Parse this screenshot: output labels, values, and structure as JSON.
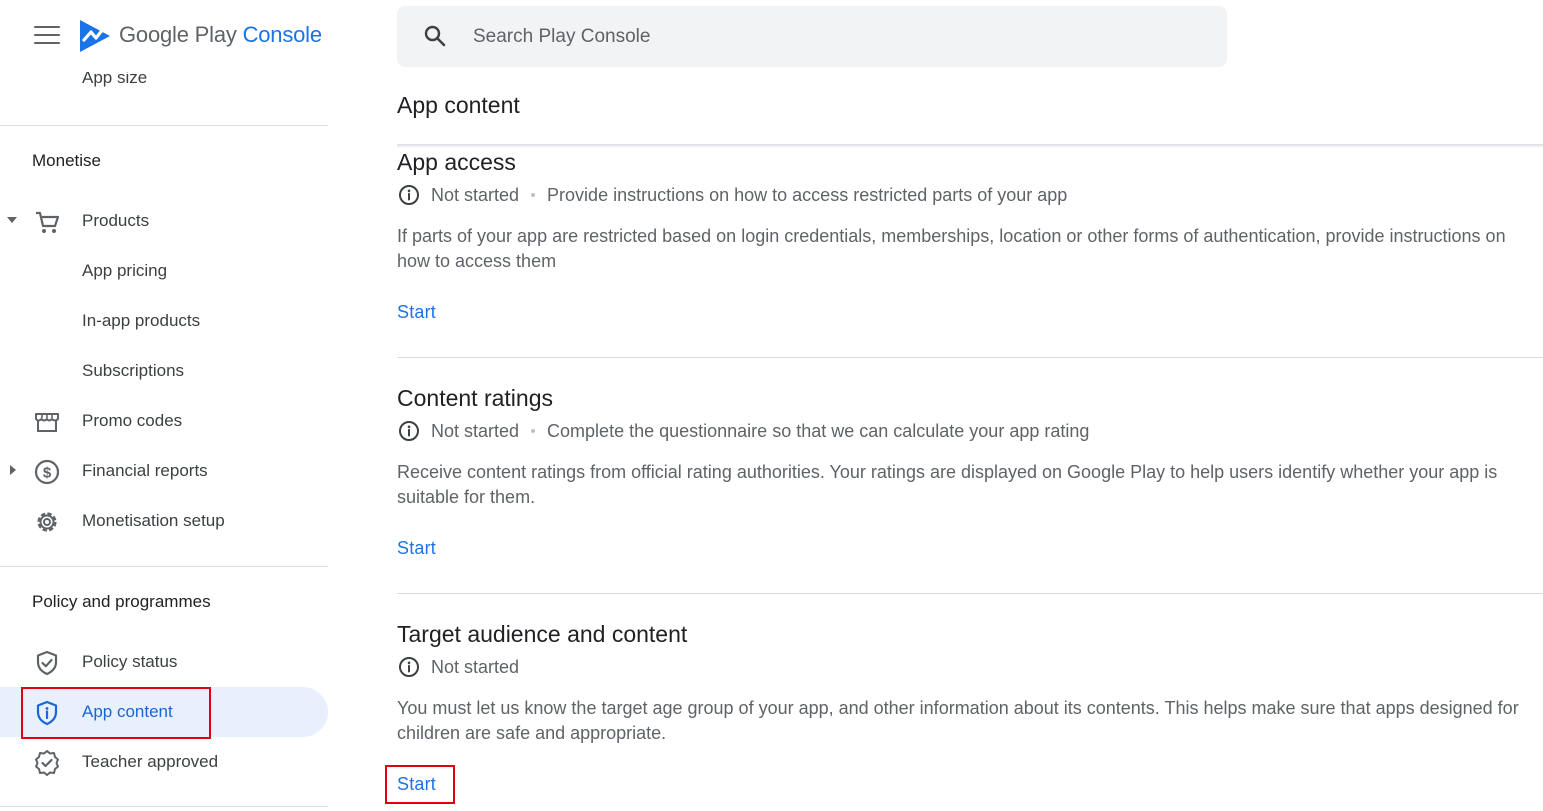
{
  "header": {
    "brand_google_play": "Google Play",
    "brand_console": "Console"
  },
  "search": {
    "placeholder": "Search Play Console"
  },
  "sidebar": {
    "partial_item": "App size",
    "monetise": {
      "title": "Monetise",
      "items": [
        {
          "label": "Products",
          "icon": "cart-icon",
          "expanded": true
        },
        {
          "label": "App pricing"
        },
        {
          "label": "In-app products"
        },
        {
          "label": "Subscriptions"
        },
        {
          "label": "Promo codes",
          "icon": "store-icon"
        },
        {
          "label": "Financial reports",
          "icon": "dollar-icon",
          "expanded": false
        },
        {
          "label": "Monetisation setup",
          "icon": "gear-icon"
        }
      ]
    },
    "policy": {
      "title": "Policy and programmes",
      "items": [
        {
          "label": "Policy status",
          "icon": "shield-check-icon"
        },
        {
          "label": "App content",
          "icon": "shield-info-icon",
          "active": true
        },
        {
          "label": "Teacher approved",
          "icon": "badge-check-icon"
        }
      ]
    }
  },
  "main": {
    "title": "App content",
    "sections": [
      {
        "title": "App access",
        "status": "Not started",
        "summary": "Provide instructions on how to access restricted parts of your app",
        "description": "If parts of your app are restricted based on login credentials, memberships, location or other forms of authentication, provide instructions on how to access them",
        "action": "Start"
      },
      {
        "title": "Content ratings",
        "status": "Not started",
        "summary": "Complete the questionnaire so that we can calculate your app rating",
        "description": "Receive content ratings from official rating authorities. Your ratings are displayed on Google Play to help users identify whether your app is suitable for them.",
        "action": "Start"
      },
      {
        "title": "Target audience and content",
        "status": "Not started",
        "summary": "",
        "description": "You must let us know the target age group of your app, and other information about its contents. This helps make sure that apps designed for children are safe and appropriate.",
        "action": "Start"
      }
    ]
  },
  "colors": {
    "accent": "#1a73e8",
    "active_bg": "#e8f0fe",
    "highlight_box": "#e0000f"
  }
}
